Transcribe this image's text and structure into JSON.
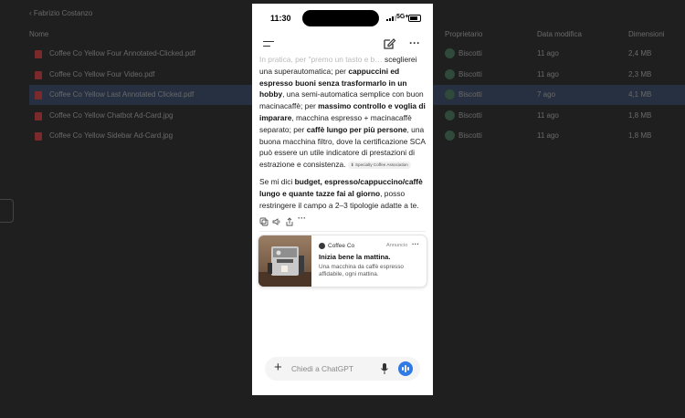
{
  "background": {
    "breadcrumb": "‹ Fabrizio Costanzo",
    "columns": {
      "name": "Nome",
      "owner": "Proprietario",
      "modified": "Data modifica",
      "size": "Dimensioni"
    },
    "files": [
      {
        "name": "Coffee Co Yellow Four Annotated-Clicked.pdf",
        "owner": "Biscotti",
        "modified": "11 ago",
        "size": "2,4 MB",
        "selected": false
      },
      {
        "name": "Coffee Co Yellow Four Video.pdf",
        "owner": "Biscotti",
        "modified": "11 ago",
        "size": "2,3 MB",
        "selected": false
      },
      {
        "name": "Coffee Co Yellow Last Annotated Clicked.pdf",
        "owner": "Biscotti",
        "modified": "7 ago",
        "size": "4,1 MB",
        "selected": true
      },
      {
        "name": "Coffee Co Yellow Chatbot Ad-Card.jpg",
        "owner": "Biscotti",
        "modified": "11 ago",
        "size": "1,8 MB",
        "selected": false
      },
      {
        "name": "Coffee Co Yellow Sidebar Ad-Card.jpg",
        "owner": "Biscotti",
        "modified": "11 ago",
        "size": "1,8 MB",
        "selected": false
      }
    ]
  },
  "phone": {
    "status": {
      "time": "11:30",
      "network": "5G+"
    },
    "message": {
      "faded_line": "In pratica, per \"premo un tasto e b…",
      "p1_a": "sceglierei una superautomatica; per ",
      "p1_b": "cappuccini ed espresso buoni senza trasformarlo in un hobby",
      "p1_c": ", una semi-automatica semplice con buon macinacaffè; per ",
      "p1_d": "massimo controllo e voglia di imparare",
      "p1_e": ", macchina espresso + macinacaffè separato; per ",
      "p1_f": "caffè lungo per più persone",
      "p1_g": ", una buona macchina filtro, dove la certificazione SCA può essere un utile indicatore di prestazioni di estrazione e consistenza.",
      "citation": "Specialty Coffee Association",
      "p2_a": "Se mi dici ",
      "p2_b": "budget, espresso/cappuccino/caffè lungo e quante tazze fai al giorno",
      "p2_c": ", posso restringere il campo a 2–3 tipologie adatte a te."
    },
    "ad": {
      "brand": "Coffee Co",
      "tag": "Annuncio",
      "title": "Inizia bene la mattina.",
      "description": "Una macchina da caffè espresso affidabile, ogni mattina."
    },
    "composer": {
      "placeholder": "Chiedi a ChatGPT"
    }
  }
}
